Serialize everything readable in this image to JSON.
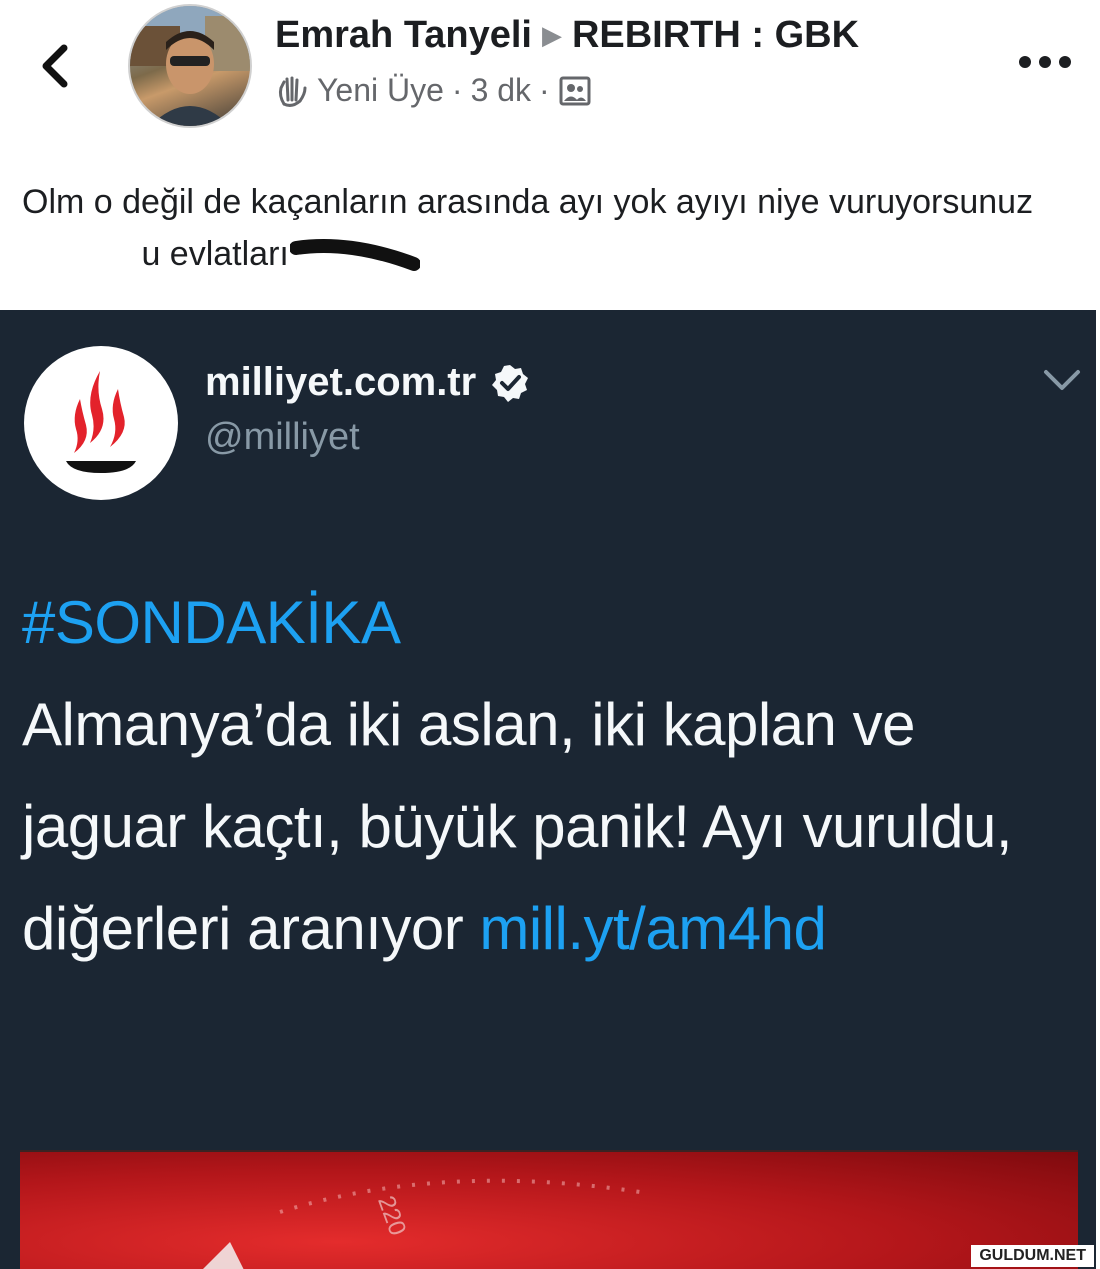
{
  "post": {
    "author": "Emrah Tanyeli",
    "group": "REBIRTH : GBK",
    "badge": "Yeni Üye",
    "time": "3 dk",
    "separator": "·",
    "text_part1": "Olm o değil de kaçanların arasında ayı yok ayıyı niye vuruyorsunuz",
    "text_part2": "u evlatları"
  },
  "icons": {
    "back": "chevron-left-icon",
    "more": "more-dots-icon",
    "badge": "waving-hand-icon",
    "privacy": "group-icon",
    "verified": "verified-badge-icon",
    "tweet_menu": "chevron-down-icon"
  },
  "tweet": {
    "name": "milliyet.com.tr",
    "handle": "@milliyet",
    "hashtag": "#SONDAKİKA",
    "body": "Almanya’da iki aslan, iki kaplan ve jaguar kaçtı, büyük panik! Ayı vuruldu, diğerleri aranıyor ",
    "link": "mill.yt/am4hd",
    "media_dial": "220"
  },
  "watermark": "GULDUM.NET",
  "colors": {
    "tweet_bg": "#1b2633",
    "link": "#1da1f2",
    "logo_red": "#e3222b"
  }
}
